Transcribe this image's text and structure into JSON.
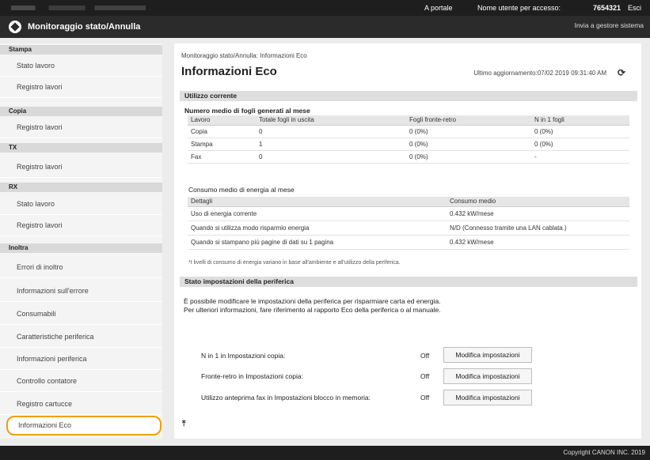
{
  "topbar": {
    "portal_link": "A portale",
    "user_label": "Nome utente per accesso:",
    "user_id": "7654321",
    "logout": "Esci"
  },
  "header": {
    "app_title": "Monitoraggio stato/Annulla",
    "send_to_admin": "Invia a gestore sistema"
  },
  "sidebar": {
    "sections": [
      {
        "label": "Stampa",
        "items": [
          "Stato lavoro",
          "Registro lavori"
        ]
      },
      {
        "label": "Copia",
        "items": [
          "Registro lavori"
        ]
      },
      {
        "label": "TX",
        "items": [
          "Registro lavori"
        ]
      },
      {
        "label": "RX",
        "items": [
          "Stato lavoro",
          "Registro lavori"
        ]
      },
      {
        "label": "Inoltra",
        "items": [
          "Errori di inoltro",
          "Informazioni sull'errore",
          "Consumabili",
          "Caratteristiche periferica",
          "Informazioni periferica",
          "Controllo contatore",
          "Registro cartucce",
          "Informazioni Eco"
        ]
      }
    ],
    "active_item": "Informazioni Eco"
  },
  "main": {
    "breadcrumb": "Monitoraggio stato/Annulla: Informazioni Eco",
    "title": "Informazioni Eco",
    "last_updated": "Ultimo aggiornamento:07/02 2019 09:31:40 AM",
    "usage_section": "Utilizzo corrente",
    "sheets_heading": "Numero medio di fogli generati al mese",
    "sheets_columns": [
      "Lavoro",
      "Totale fogli in uscita",
      "Fogli fronte-retro",
      "N in 1 fogli"
    ],
    "sheets_rows": [
      [
        "Copia",
        "0",
        "0 (0%)",
        "0 (0%)"
      ],
      [
        "Stampa",
        "1",
        "0 (0%)",
        "0 (0%)"
      ],
      [
        "Fax",
        "0",
        "0 (0%)",
        "-"
      ]
    ],
    "energy_heading": "Consumo medio di energia al mese",
    "energy_columns": [
      "Dettagli",
      "Consumo medio"
    ],
    "energy_rows": [
      [
        "Uso di energia corrente",
        "0.432 kW/mese"
      ],
      [
        "Quando si utilizza modo risparmio energia",
        "N/D (Connesso tramite una LAN cablata.)"
      ],
      [
        "Quando si stampano più pagine di dati su 1 pagina",
        "0.432 kW/mese"
      ]
    ],
    "energy_note": "*I livelli di consumo di energia variano in base all'ambiente e all'utilizzo della periferica.",
    "settings_section": "Stato impostazioni della periferica",
    "settings_para1": "È possibile modificare le impostazioni della periferica per risparmiare carta ed energia.",
    "settings_para2": "Per ulteriori informazioni, fare riferimento al rapporto Eco della periferica o al manuale.",
    "settings": [
      {
        "label": "N in 1 in Impostazioni copia:",
        "value": "Off",
        "button": "Modifica impostazioni"
      },
      {
        "label": "Fronte-retro in Impostazioni copia:",
        "value": "Off",
        "button": "Modifica impostazioni"
      },
      {
        "label": "Utilizzo anteprima fax in Impostazioni blocco in memoria:",
        "value": "Off",
        "button": "Modifica impostazioni"
      }
    ],
    "to_top_icon": "to-top-icon",
    "to_top_glyph": "⤒"
  },
  "footer": {
    "copyright": "Copyright CANON INC. 2019"
  },
  "colors": {
    "active_outline": "#f0a000",
    "header_bg": "#2b2b2b",
    "topbar_bg": "#1e1e1e"
  }
}
